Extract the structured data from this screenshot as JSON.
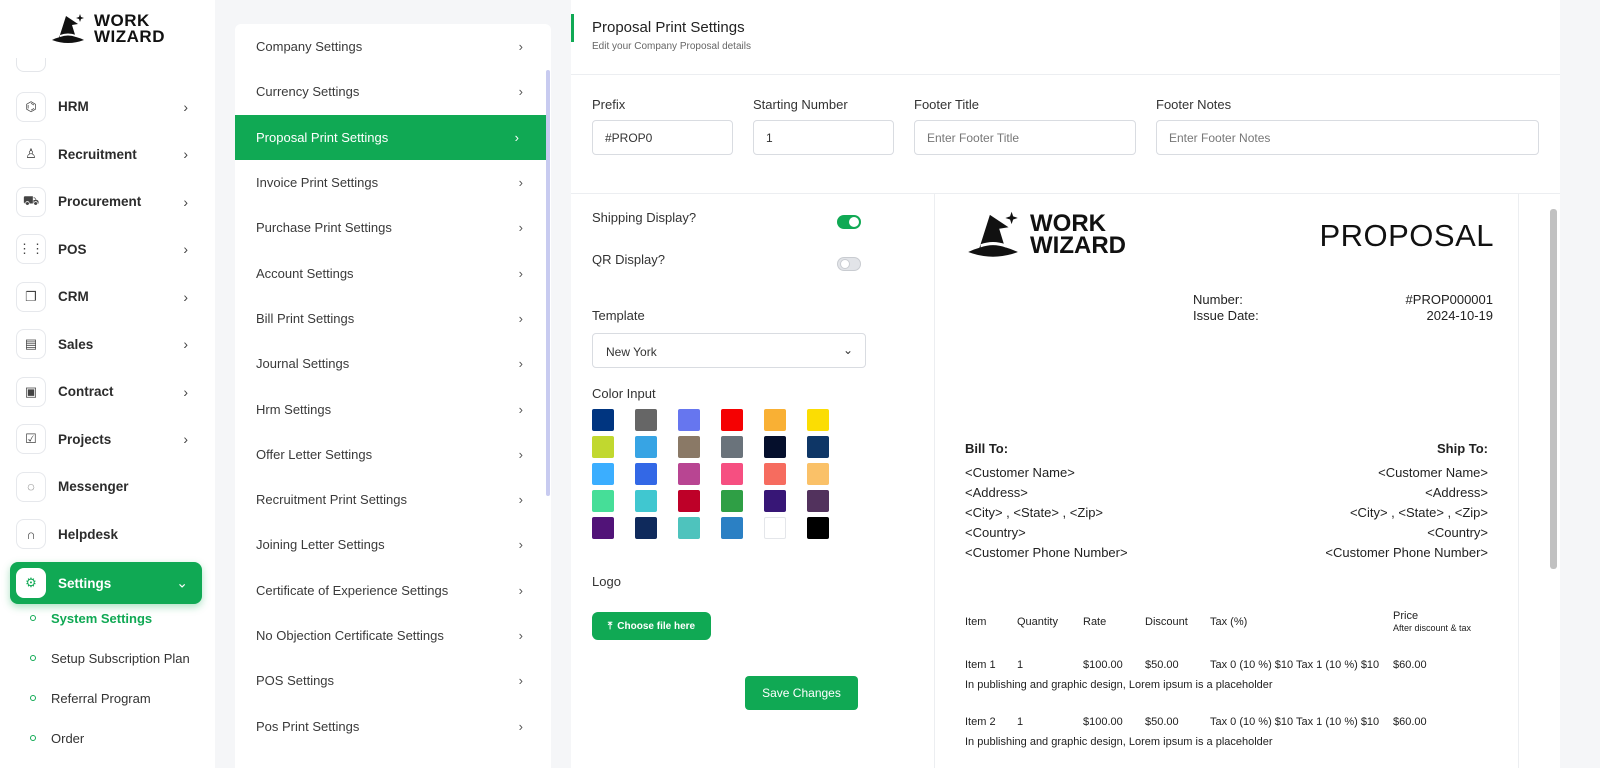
{
  "brand": {
    "line1": "WORK",
    "line2": "WIZARD"
  },
  "nav": {
    "items": [
      {
        "label": "HRM",
        "icon": "hrm-icon",
        "glyph": "⌬"
      },
      {
        "label": "Recruitment",
        "icon": "user-plus-icon",
        "glyph": "♙"
      },
      {
        "label": "Procurement",
        "icon": "cart-icon",
        "glyph": "⛟"
      },
      {
        "label": "POS",
        "icon": "grid-icon",
        "glyph": "⋮⋮"
      },
      {
        "label": "CRM",
        "icon": "layers-icon",
        "glyph": "❐"
      },
      {
        "label": "Sales",
        "icon": "document-icon",
        "glyph": "▤"
      },
      {
        "label": "Contract",
        "icon": "contract-icon",
        "glyph": "▣"
      },
      {
        "label": "Projects",
        "icon": "check-square-icon",
        "glyph": "☑"
      },
      {
        "label": "Messenger",
        "icon": "chat-icon",
        "glyph": "◌"
      },
      {
        "label": "Helpdesk",
        "icon": "headset-icon",
        "glyph": "∩"
      },
      {
        "label": "Settings",
        "icon": "gear-icon",
        "glyph": "⚙"
      }
    ],
    "sub_items": [
      {
        "label": "System Settings"
      },
      {
        "label": "Setup Subscription Plan"
      },
      {
        "label": "Referral Program"
      },
      {
        "label": "Order"
      }
    ]
  },
  "settings_menu": [
    "Company Settings",
    "Currency Settings",
    "Proposal Print Settings",
    "Invoice Print Settings",
    "Purchase Print Settings",
    "Account Settings",
    "Bill Print Settings",
    "Journal Settings",
    "Hrm Settings",
    "Offer Letter Settings",
    "Recruitment Print Settings",
    "Joining Letter Settings",
    "Certificate of Experience Settings",
    "No Objection Certificate Settings",
    "POS Settings",
    "Pos Print Settings"
  ],
  "main": {
    "title": "Proposal Print Settings",
    "subtitle": "Edit your Company Proposal details",
    "prefix": {
      "label": "Prefix",
      "value": "#PROP0"
    },
    "starting_number": {
      "label": "Starting Number",
      "value": "1"
    },
    "footer_title": {
      "label": "Footer Title",
      "placeholder": "Enter Footer Title"
    },
    "footer_notes": {
      "label": "Footer Notes",
      "placeholder": "Enter Footer Notes"
    },
    "shipping_display": {
      "label": "Shipping Display?",
      "on": true
    },
    "qr_display": {
      "label": "QR Display?",
      "on": false
    },
    "template": {
      "label": "Template",
      "value": "New York"
    },
    "color_input_label": "Color Input",
    "colors": [
      "#003580",
      "#666666",
      "#6676ef",
      "#f50102",
      "#f9b034",
      "#fbdd03",
      "#c1d82f",
      "#37a4e4",
      "#8a7966",
      "#6a737b",
      "#050f2c",
      "#0e3666",
      "#3baeff",
      "#3368e6",
      "#b84592",
      "#f64f81",
      "#f66c5f",
      "#fac168",
      "#46de98",
      "#40c7d0",
      "#be0028",
      "#2f9f45",
      "#371676",
      "#52325d",
      "#511378",
      "#0f2a5c",
      "#4ec3bd",
      "#2b80c4",
      "#ffffff",
      "#000000"
    ],
    "logo_label": "Logo",
    "upload_label": "Choose file here",
    "save_label": "Save Changes"
  },
  "preview": {
    "title": "PROPOSAL",
    "number_label": "Number:",
    "number_value": "#PROP000001",
    "date_label": "Issue Date:",
    "date_value": "2024-10-19",
    "bill_to": "Bill To:",
    "ship_to": "Ship To:",
    "address_lines": [
      "<Customer Name>",
      "<Address>",
      "<City> , <State> , <Zip>",
      "<Country>",
      "<Customer Phone Number>"
    ],
    "ship_lines": [
      "<Customer Name>",
      "<Address>",
      "<City> , <State> , <Zip>",
      "<Country>",
      "<Customer Phone Number>"
    ],
    "columns": {
      "item": "Item",
      "quantity": "Quantity",
      "rate": "Rate",
      "discount": "Discount",
      "tax": "Tax (%)",
      "price": "Price",
      "price_note": "After discount & tax"
    },
    "rows": [
      {
        "item": "Item 1",
        "qty": "1",
        "rate": "$100.00",
        "discount": "$50.00",
        "tax": "Tax 0 (10 %) $10 Tax 1 (10 %) $10",
        "price": "$60.00",
        "desc": "In publishing and graphic design, Lorem ipsum is a placeholder"
      },
      {
        "item": "Item 2",
        "qty": "1",
        "rate": "$100.00",
        "discount": "$50.00",
        "tax": "Tax 0 (10 %) $10 Tax 1 (10 %) $10",
        "price": "$60.00",
        "desc": "In publishing and graphic design, Lorem ipsum is a placeholder"
      }
    ]
  }
}
